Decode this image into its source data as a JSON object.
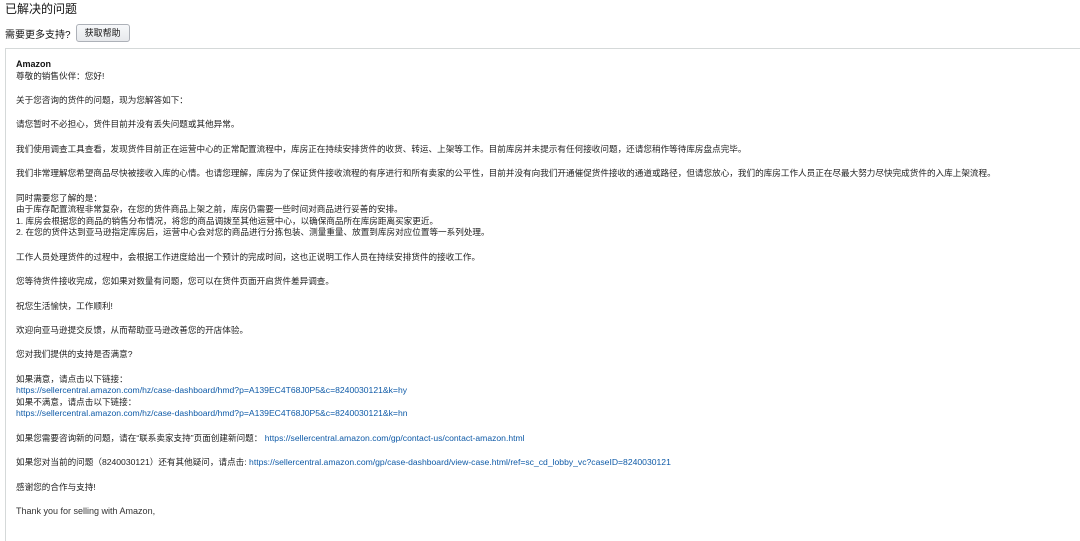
{
  "header": {
    "title": "已解决的问题",
    "support_question": "需要更多支持?",
    "help_button_label": "获取帮助"
  },
  "message": {
    "sender": "Amazon",
    "greeting": "尊敬的销售伙伴：您好!",
    "intro": "关于您咨询的货件的问题，现为您解答如下：",
    "p1": "请您暂时不必担心，货件目前并没有丢失问题或其他异常。",
    "p2": "我们使用调查工具查看，发现货件目前正在运营中心的正常配置流程中，库房正在持续安排货件的收货、转运、上架等工作。目前库房并未提示有任何接收问题，还请您稍作等待库房盘点完毕。",
    "p3": "我们非常理解您希望商品尽快被接收入库的心情。也请您理解，库房为了保证货件接收流程的有序进行和所有卖家的公平性，目前并没有向我们开通催促货件接收的通道或路径，但请您放心，我们的库房工作人员正在尽最大努力尽快完成货件的入库上架流程。",
    "p4_lines": [
      "同时需要您了解的是：",
      "由于库存配置流程非常复杂，在您的货件商品上架之前，库房仍需要一些时间对商品进行妥善的安排。",
      "1. 库房会根据您的商品的销售分布情况，将您的商品调拨至其他运营中心，以确保商品所在库房距离买家更近。",
      "2. 在您的货件达到亚马逊指定库房后，运营中心会对您的商品进行分拣包装、测量重量、放置到库房对应位置等一系列处理。"
    ],
    "p5": "工作人员处理货件的过程中，会根据工作进度给出一个预计的完成时间，这也正说明工作人员在持续安排货件的接收工作。",
    "p6": "您等待货件接收完成，您如果对数量有问题，您可以在货件页面开启货件差异调查。",
    "p7": "祝您生活愉快，工作顺利!",
    "p8": "欢迎向亚马逊提交反馈，从而帮助亚马逊改善您的开店体验。",
    "p9": "您对我们提供的支持是否满意?",
    "satisfied_label": "如果满意，请点击以下链接：",
    "satisfied_link": "https://sellercentral.amazon.com/hz/case-dashboard/hmd?p=A139EC4T68J0P5&c=8240030121&k=hy",
    "unsatisfied_label": "如果不满意，请点击以下链接：",
    "unsatisfied_link": "https://sellercentral.amazon.com/hz/case-dashboard/hmd?p=A139EC4T68J0P5&c=8240030121&k=hn",
    "contact_text": "如果您需要咨询新的问题，请在“联系卖家支持”页面创建新问题：",
    "contact_link": "https://sellercentral.amazon.com/gp/contact-us/contact-amazon.html",
    "case_text": "如果您对当前的问题（8240030121）还有其他疑问，请点击:",
    "case_link": "https://sellercentral.amazon.com/gp/case-dashboard/view-case.html/ref=sc_cd_lobby_vc?caseID=8240030121",
    "thanks": "感谢您的合作与支持!",
    "closing_en": "Thank you for selling with Amazon,"
  },
  "colors": {
    "link": "#0e5aa7",
    "border": "#d5d9d9",
    "button_border": "#adb1b8"
  }
}
